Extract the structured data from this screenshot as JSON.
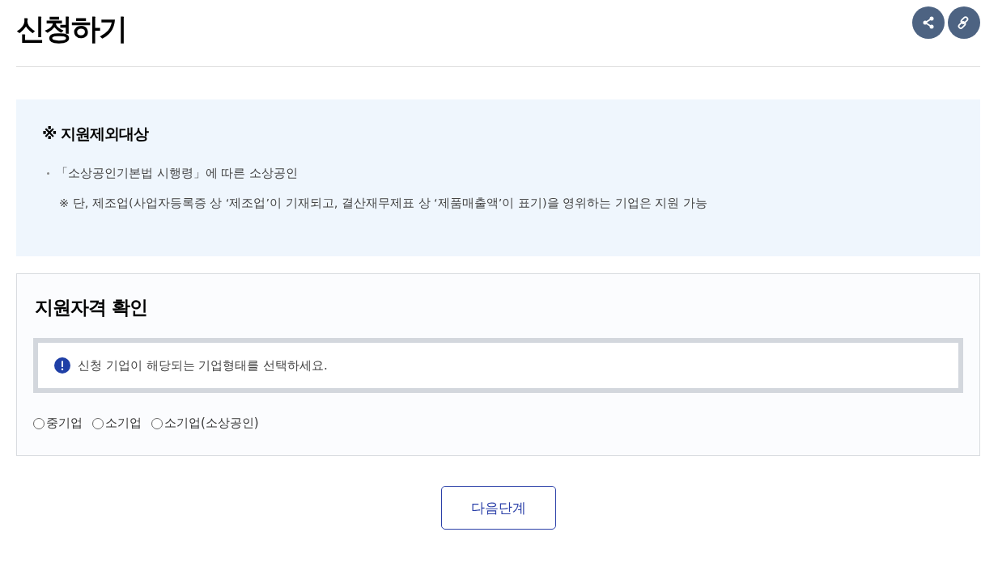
{
  "page": {
    "title": "신청하기"
  },
  "exclusion": {
    "heading": "※ 지원제외대상",
    "items": [
      {
        "text": "「소상공인기본법 시행령」에 따른 소상공인",
        "note": "※ 단, 제조업(사업자등록증 상 ‘제조업’이 기재되고, 결산재무제표 상 ‘제품매출액’이 표기)을 영위하는 기업은 지원 가능"
      }
    ]
  },
  "qualification": {
    "heading": "지원자격 확인",
    "notice": "신청 기업이 해당되는 기업형태를 선택하세요.",
    "options": [
      {
        "label": "중기업",
        "selected": false
      },
      {
        "label": "소기업",
        "selected": false
      },
      {
        "label": "소기업(소상공인)",
        "selected": false
      }
    ]
  },
  "next_button": "다음단계"
}
